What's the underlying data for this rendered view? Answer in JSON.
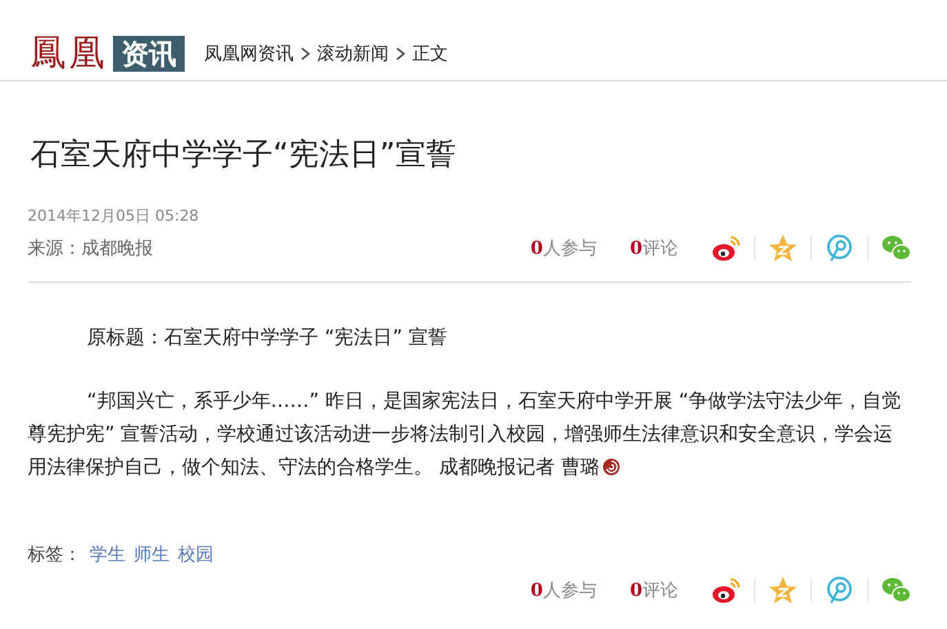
{
  "header": {
    "logo_main": "鳳凰",
    "logo_tag": "资讯",
    "breadcrumb": [
      "凤凰网资讯",
      "滚动新闻",
      "正文"
    ]
  },
  "article": {
    "title": "石室天府中学学子“宪法日”宣誓",
    "datetime": "2014年12月05日  05:28",
    "source_label": "来源：",
    "source": "成都晚报",
    "paragraphs": [
      "原标题：石室天府中学学子 “宪法日” 宣誓",
      "“邦国兴亡，系乎少年……” 昨日，是国家宪法日，石室天府中学开展 “争做学法守法少年，自觉尊宪护宪” 宣誓活动，学校通过该活动进一步将法制引入校园，增强师生法律意识和安全意识，学会运用法律保护自己，做个知法、守法的合格学生。 成都晚报记者  曹璐"
    ],
    "tags_label": "标签：",
    "tags": [
      "学生",
      "师生",
      "校园"
    ]
  },
  "share_bars": [
    {
      "participants": "0",
      "participants_label": "人参与",
      "comments": "0",
      "comments_label": "评论"
    },
    {
      "participants": "0",
      "participants_label": "人参与",
      "comments": "0",
      "comments_label": "评论"
    }
  ]
}
